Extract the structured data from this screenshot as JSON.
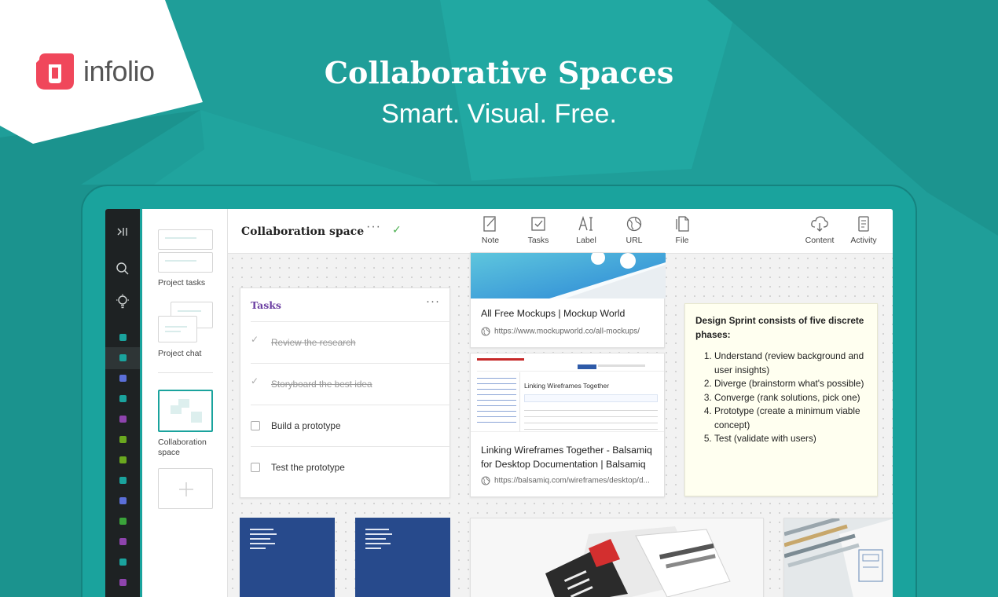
{
  "brand": {
    "name": "infolio",
    "mark_color": "#f0475b"
  },
  "hero": {
    "title": "Collaborative Spaces",
    "subtitle": "Smart. Visual. Free."
  },
  "colors": {
    "background": "#1f9e99",
    "accent_teal": "#1aa39d",
    "rail": "#1e2223",
    "task_title": "#6a3ea1",
    "note_bg": "#fffff0"
  },
  "rail": {
    "icons": [
      "collapse-icon",
      "search-icon",
      "lightbulb-icon"
    ],
    "space_dots": [
      "#1aa39d",
      "#1aa39d",
      "#5b6fd8",
      "#1aa39d",
      "#8e44ad",
      "#6aa81f",
      "#6aa81f",
      "#1aa39d",
      "#5b6fd8",
      "#3aa33a",
      "#8e44ad",
      "#1aa39d",
      "#8e44ad"
    ]
  },
  "sidebar": {
    "items": [
      {
        "label": "Project tasks"
      },
      {
        "label": "Project chat"
      },
      {
        "label": "Collaboration space",
        "active": true
      }
    ],
    "add_icon": "plus-icon"
  },
  "topbar": {
    "title": "Collaboration space",
    "more": "···",
    "saved": "✓",
    "tools": [
      {
        "label": "Note",
        "icon": "note-icon"
      },
      {
        "label": "Tasks",
        "icon": "checkbox-icon"
      },
      {
        "label": "Label",
        "icon": "text-label-icon"
      },
      {
        "label": "URL",
        "icon": "globe-icon"
      },
      {
        "label": "File",
        "icon": "file-icon"
      }
    ],
    "right_tools": [
      {
        "label": "Content",
        "icon": "cloud-icon"
      },
      {
        "label": "Activity",
        "icon": "document-icon"
      }
    ]
  },
  "tasks_card": {
    "title": "Tasks",
    "more": "···",
    "items": [
      {
        "text": "Review the research",
        "done": true
      },
      {
        "text": "Storyboard the best idea",
        "done": true
      },
      {
        "text": "Build a prototype",
        "done": false
      },
      {
        "text": "Test the prototype",
        "done": false
      }
    ]
  },
  "links": [
    {
      "title": "All Free Mockups | Mockup World",
      "url": "https://www.mockupworld.co/all-mockups/"
    },
    {
      "title": "Linking Wireframes Together - Balsamiq for Desktop Documentation | Balsamiq",
      "url": "https://balsamiq.com/wireframes/desktop/d..."
    }
  ],
  "link_preview": {
    "heading": "Linking Wireframes Together"
  },
  "note_card": {
    "title": "Design Sprint consists of five discrete phases:",
    "items": [
      "Understand (review background and user insights)",
      "Diverge (brainstorm what's possible)",
      "Converge (rank solutions, pick one)",
      "Prototype (create a minimum viable concept)",
      "Test (validate with users)"
    ]
  }
}
